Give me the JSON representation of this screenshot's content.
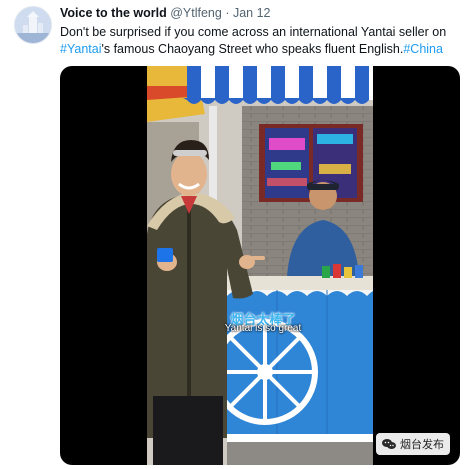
{
  "tweet": {
    "author_name": "Voice to the world",
    "handle": "@Ytlfeng",
    "separator": "·",
    "date": "Jan 12",
    "text_before": "Don't be surprised if you come across an international Yantai seller on ",
    "hashtag_yantai": "#Yantai",
    "text_middle": "'s famous Chaoyang Street who speaks fluent English.",
    "hashtag_china": "#China"
  },
  "media": {
    "subtitle_cn": "烟台太棒了",
    "subtitle_en": "Yantai is so great",
    "watermark": "烟台发布",
    "watermark_icon": "wechat-icon"
  },
  "colors": {
    "link": "#1d9bf0",
    "awning_blue": "#2b64c8",
    "cart_blue": "#2f86d6",
    "subtitle": "#3fb6f0"
  }
}
